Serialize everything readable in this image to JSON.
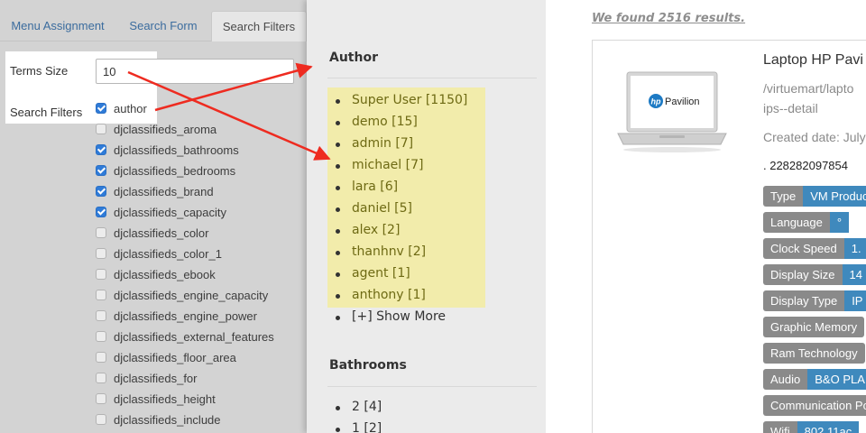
{
  "admin": {
    "tabs": [
      "Menu Assignment",
      "Search Form",
      "Search Filters"
    ],
    "terms_size_label": "Terms Size",
    "terms_size_value": "10",
    "search_filters_label": "Search Filters",
    "filters": [
      {
        "name": "author",
        "checked": true
      },
      {
        "name": "djclassifieds_aroma",
        "checked": false
      },
      {
        "name": "djclassifieds_bathrooms",
        "checked": true
      },
      {
        "name": "djclassifieds_bedrooms",
        "checked": true
      },
      {
        "name": "djclassifieds_brand",
        "checked": true
      },
      {
        "name": "djclassifieds_capacity",
        "checked": true
      },
      {
        "name": "djclassifieds_color",
        "checked": false
      },
      {
        "name": "djclassifieds_color_1",
        "checked": false
      },
      {
        "name": "djclassifieds_ebook",
        "checked": false
      },
      {
        "name": "djclassifieds_engine_capacity",
        "checked": false
      },
      {
        "name": "djclassifieds_engine_power",
        "checked": false
      },
      {
        "name": "djclassifieds_external_features",
        "checked": false
      },
      {
        "name": "djclassifieds_floor_area",
        "checked": false
      },
      {
        "name": "djclassifieds_for",
        "checked": false
      },
      {
        "name": "djclassifieds_height",
        "checked": false
      },
      {
        "name": "djclassifieds_include",
        "checked": false
      }
    ]
  },
  "module": {
    "author_heading": "Author",
    "authors": [
      "Super User [1150]",
      "demo [15]",
      "admin [7]",
      "michael [7]",
      "lara [6]",
      "daniel [5]",
      "alex [2]",
      "thanhnv [2]",
      "agent [1]",
      "anthony [1]"
    ],
    "show_more": "[+] Show More",
    "bathrooms_heading": "Bathrooms",
    "bathrooms": [
      "2 [4]",
      "1 [2]"
    ]
  },
  "results": {
    "found_text": "We found 2516 results.",
    "product_title": "Laptop HP Pavi",
    "product_path_1": "/virtuemart/lapto",
    "product_path_2": "ips--detail",
    "created_date": "Created date: July",
    "product_number": ". 228282097854",
    "laptop_brand": "Pavilion",
    "tags": [
      {
        "key": "Type",
        "value": "VM Produc"
      },
      {
        "key": "Language",
        "value": "°"
      },
      {
        "key": "Clock Speed",
        "value": "1."
      },
      {
        "key": "Display Size",
        "value": "14"
      },
      {
        "key": "Display Type",
        "value": "IP"
      },
      {
        "key": "Graphic Memory",
        "value": ""
      },
      {
        "key": "Ram Technology",
        "value": ""
      },
      {
        "key": "Audio",
        "value": "B&O PLA"
      },
      {
        "key": "Communication Po",
        "value": ""
      },
      {
        "key": "Wifi",
        "value": "802.11ac"
      }
    ]
  },
  "colors": {
    "highlight": "#f2ecab",
    "arrow": "#ee2b20",
    "tag_value": "#3f89bd",
    "checkbox_on": "#2f7bd8"
  }
}
